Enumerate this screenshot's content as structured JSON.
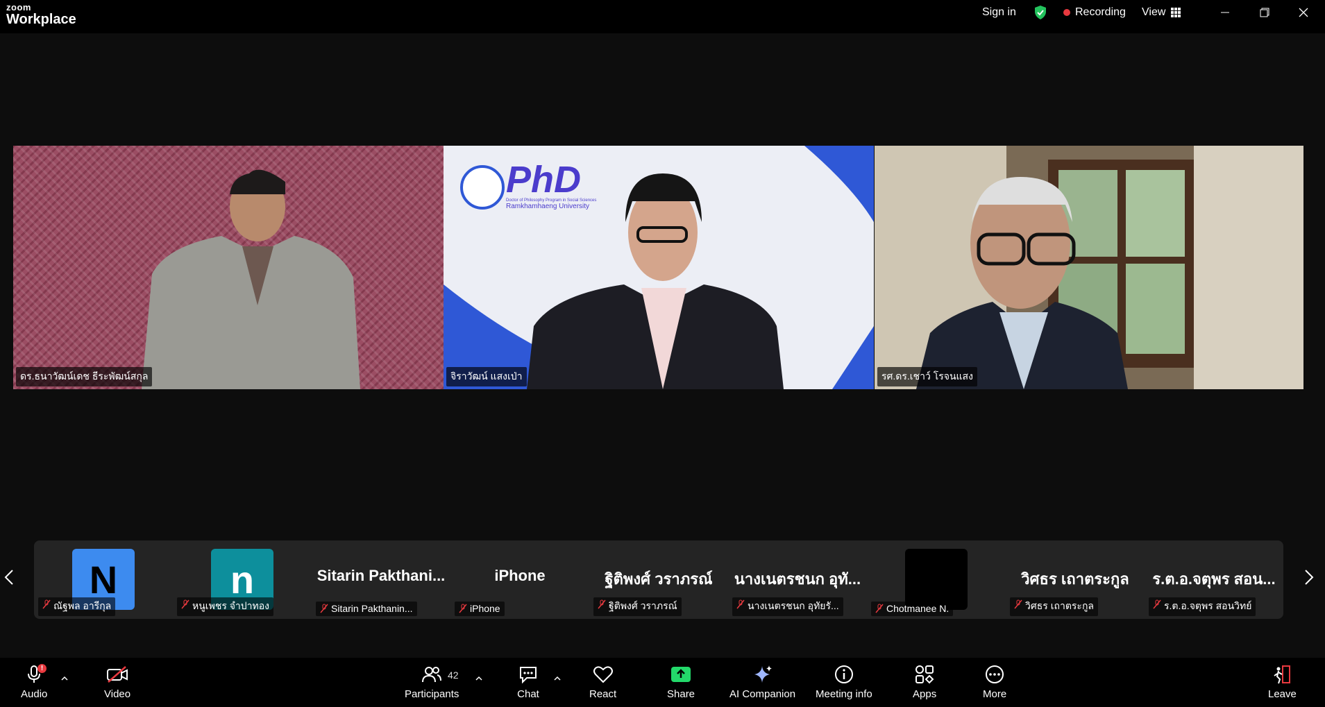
{
  "app": {
    "brand_top": "zoom",
    "brand_bottom": "Workplace"
  },
  "titlebar": {
    "sign_in": "Sign in",
    "recording": "Recording",
    "view": "View"
  },
  "colors": {
    "active_speaker": "#23d96a",
    "recording_dot": "#e8393f",
    "share_green": "#23d96a"
  },
  "tiles": [
    {
      "name": "ดร.ธนาวัฒน์เดช  ธีระพัฒน์สกุล"
    },
    {
      "name": "จิราวัฒน์ แสงเป่า",
      "bg_logo": "PhD",
      "bg_logo_sub1": "Doctor of Philosophy Program in Social Sciences",
      "bg_logo_sub2": "Ramkhamhaeng University"
    },
    {
      "name": "รศ.ดร.เชาว์ โรจนแสง",
      "active": true
    }
  ],
  "filmstrip": [
    {
      "avatar_letter": "N",
      "avatar_color": "#3d8bef",
      "avatar_text_color": "#000",
      "label": "ณัฐพล อารีกุล"
    },
    {
      "avatar_letter": "n",
      "avatar_color": "#0d8f9c",
      "avatar_text_color": "#fff",
      "label": "หนูเพชร จำปาทอง"
    },
    {
      "display_name": "Sitarin  Pakthani...",
      "label": "Sitarin Pakthanin..."
    },
    {
      "display_name": "iPhone",
      "label": "iPhone"
    },
    {
      "display_name": "ฐิติพงศ์ วราภรณ์",
      "label": "ฐิติพงศ์ วราภรณ์"
    },
    {
      "display_name": "นางเนตรชนก อุทั...",
      "label": "นางเนตรชนก อุทัยรั..."
    },
    {
      "avatar_letter": "",
      "avatar_color": "#000000",
      "avatar_text_color": "#fff",
      "label": "Chotmanee N."
    },
    {
      "display_name": "วิศธร เถาตระกูล",
      "label": "วิศธร เถาตระกูล"
    },
    {
      "display_name": "ร.ต.อ.จตุพร  สอน...",
      "label": "ร.ต.อ.จตุพร  สอนวิทย์"
    }
  ],
  "toolbar": {
    "audio": "Audio",
    "audio_badge": "!",
    "video": "Video",
    "participants": "Participants",
    "participants_count": "42",
    "chat": "Chat",
    "react": "React",
    "share": "Share",
    "ai_companion": "AI Companion",
    "meeting_info": "Meeting info",
    "apps": "Apps",
    "more": "More",
    "leave": "Leave"
  }
}
